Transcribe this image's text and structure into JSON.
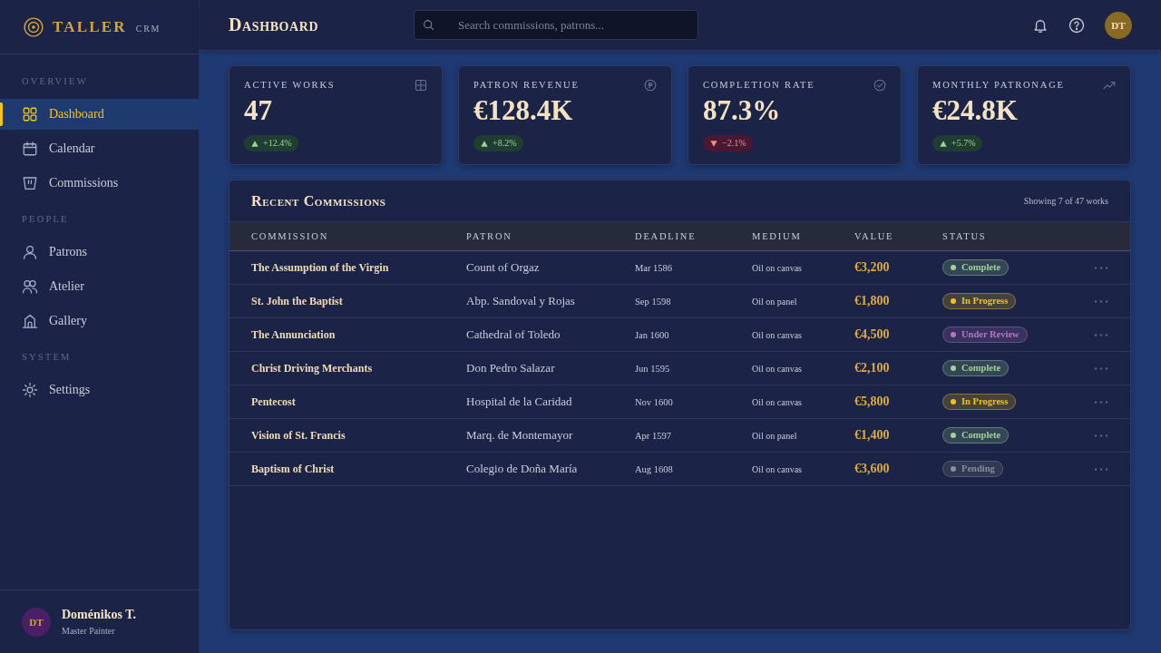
{
  "sidebar": {
    "brand": {
      "name": "TALLER",
      "suffix": "CRM"
    },
    "sections": [
      {
        "title": "OVERVIEW",
        "items": [
          {
            "label": "Dashboard",
            "selected": true
          },
          {
            "label": "Calendar",
            "selected": false
          },
          {
            "label": "Commissions",
            "selected": false
          }
        ]
      },
      {
        "title": "PEOPLE",
        "items": [
          {
            "label": "Patrons",
            "selected": false
          },
          {
            "label": "Atelier",
            "selected": false
          },
          {
            "label": "Gallery",
            "selected": false
          }
        ]
      },
      {
        "title": "SYSTEM",
        "items": [
          {
            "label": "Settings",
            "selected": false
          }
        ]
      }
    ],
    "user": {
      "initials": "DT",
      "name": "Doménikos T.",
      "role": "Master Painter"
    }
  },
  "header": {
    "title": "Dashboard",
    "search": {
      "placeholder": "Search commissions, patrons..."
    },
    "avatar": "DT"
  },
  "kpis": [
    {
      "label": "ACTIVE WORKS",
      "value": "47",
      "delta": "+12.4%",
      "rising": true
    },
    {
      "label": "PATRON REVENUE",
      "value": "€128.4K",
      "delta": "+8.2%",
      "rising": true
    },
    {
      "label": "COMPLETION RATE",
      "value": "87.3%",
      "delta": "−2.1%",
      "rising": false
    },
    {
      "label": "MONTHLY PATRONAGE",
      "value": "€24.8K",
      "delta": "+5.7%",
      "rising": true
    }
  ],
  "commissions": {
    "title": "Recent Commissions",
    "summary": "Showing 7 of 47 works",
    "columns": [
      "COMMISSION",
      "PATRON",
      "DEADLINE",
      "MEDIUM",
      "VALUE",
      "STATUS"
    ],
    "rows": [
      {
        "commission": "The Assumption of the Virgin",
        "patron": "Count of Orgaz",
        "deadline": "Mar 1586",
        "medium": "Oil on canvas",
        "value": "€3,200",
        "status": {
          "label": "Complete",
          "color": "#9fd39a"
        }
      },
      {
        "commission": "St. John the Baptist",
        "patron": "Abp. Sandoval y Rojas",
        "deadline": "Sep 1598",
        "medium": "Oil on panel",
        "value": "€1,800",
        "status": {
          "label": "In Progress",
          "color": "#f2c21b"
        }
      },
      {
        "commission": "The Annunciation",
        "patron": "Cathedral of Toledo",
        "deadline": "Jan 1600",
        "medium": "Oil on canvas",
        "value": "€4,500",
        "status": {
          "label": "Under Review",
          "color": "#b574c8"
        }
      },
      {
        "commission": "Christ Driving Merchants",
        "patron": "Don Pedro Salazar",
        "deadline": "Jun 1595",
        "medium": "Oil on canvas",
        "value": "€2,100",
        "status": {
          "label": "Complete",
          "color": "#9fd39a"
        }
      },
      {
        "commission": "Pentecost",
        "patron": "Hospital de la Caridad",
        "deadline": "Nov 1600",
        "medium": "Oil on canvas",
        "value": "€5,800",
        "status": {
          "label": "In Progress",
          "color": "#f2c21b"
        }
      },
      {
        "commission": "Vision of St. Francis",
        "patron": "Marq. de Montemayor",
        "deadline": "Apr 1597",
        "medium": "Oil on panel",
        "value": "€1,400",
        "status": {
          "label": "Complete",
          "color": "#9fd39a"
        }
      },
      {
        "commission": "Baptism of Christ",
        "patron": "Colegio de Doña María",
        "deadline": "Aug 1608",
        "medium": "Oil on canvas",
        "value": "€3,600",
        "status": {
          "label": "Pending",
          "color": "#8a8d96"
        }
      }
    ]
  }
}
